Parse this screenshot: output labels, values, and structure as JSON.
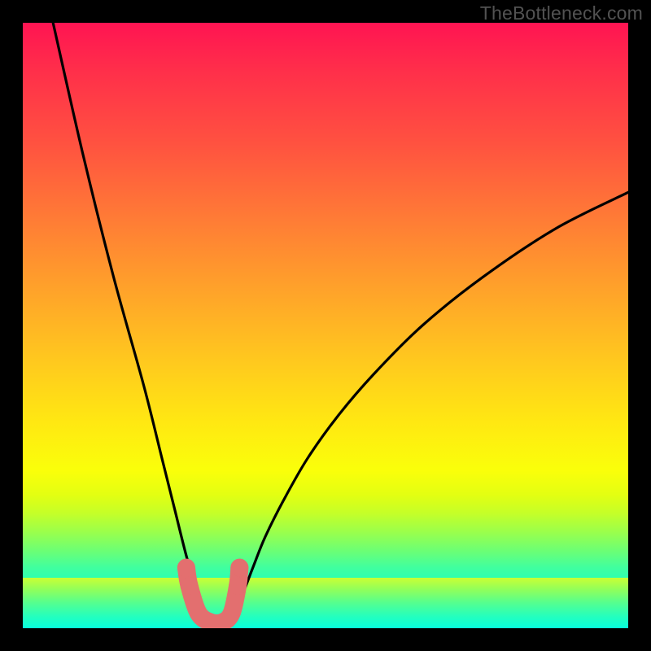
{
  "watermark": "TheBottleneck.com",
  "colors": {
    "frame": "#000000",
    "curve_stroke": "#000000",
    "marker": "#e36f6f",
    "gradient_top": "#ff1452",
    "gradient_bottom": "#00ffde"
  },
  "chart_data": {
    "type": "line",
    "title": "",
    "xlabel": "",
    "ylabel": "",
    "xlim": [
      0,
      100
    ],
    "ylim": [
      0,
      100
    ],
    "series": [
      {
        "name": "bottleneck-curve",
        "x": [
          5,
          10,
          15,
          20,
          23,
          25,
          27,
          29,
          30,
          31,
          32,
          33,
          34,
          36,
          38,
          40,
          43,
          47,
          52,
          58,
          66,
          76,
          88,
          100
        ],
        "y": [
          100,
          78,
          58,
          40,
          28,
          20,
          12,
          5,
          2,
          1,
          1,
          1,
          2,
          5,
          10,
          15,
          21,
          28,
          35,
          42,
          50,
          58,
          66,
          72
        ]
      }
    ],
    "markers": {
      "name": "highlight-points",
      "x": [
        27,
        27.5,
        29,
        31,
        33,
        34.5,
        35.5,
        35.8
      ],
      "y": [
        10,
        7,
        2.5,
        1,
        1,
        2.5,
        7,
        10
      ]
    },
    "annotations": []
  }
}
